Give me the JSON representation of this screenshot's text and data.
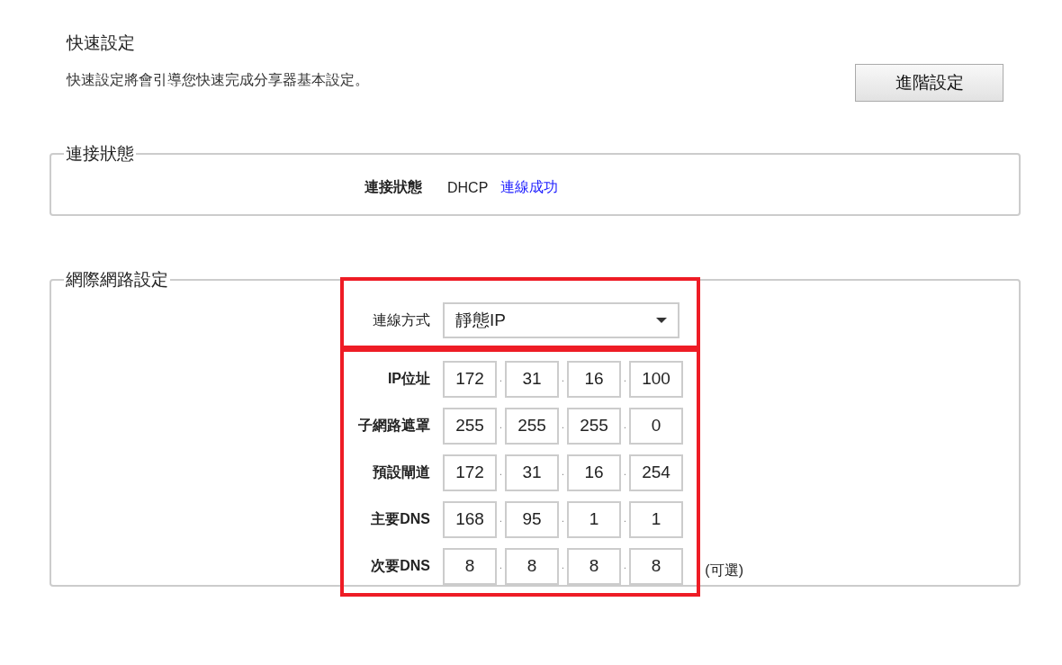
{
  "header": {
    "title": "快速設定",
    "description": "快速設定將會引導您快速完成分享器基本設定。",
    "advanced_button": "進階設定"
  },
  "connection_status": {
    "legend": "連接狀態",
    "label": "連接狀態",
    "type": "DHCP",
    "status": "連線成功"
  },
  "internet_settings": {
    "legend": "網際網路設定",
    "connection_method": {
      "label": "連線方式",
      "value": "靜態IP"
    },
    "octet_separator": ".",
    "fields": [
      {
        "label": "IP位址",
        "octets": [
          "172",
          "31",
          "16",
          "100"
        ]
      },
      {
        "label": "子網路遮罩",
        "octets": [
          "255",
          "255",
          "255",
          "0"
        ]
      },
      {
        "label": "預設閘道",
        "octets": [
          "172",
          "31",
          "16",
          "254"
        ]
      },
      {
        "label": "主要DNS",
        "octets": [
          "168",
          "95",
          "1",
          "1"
        ]
      },
      {
        "label": "次要DNS",
        "octets": [
          "8",
          "8",
          "8",
          "8"
        ],
        "note": "(可選)"
      }
    ]
  }
}
